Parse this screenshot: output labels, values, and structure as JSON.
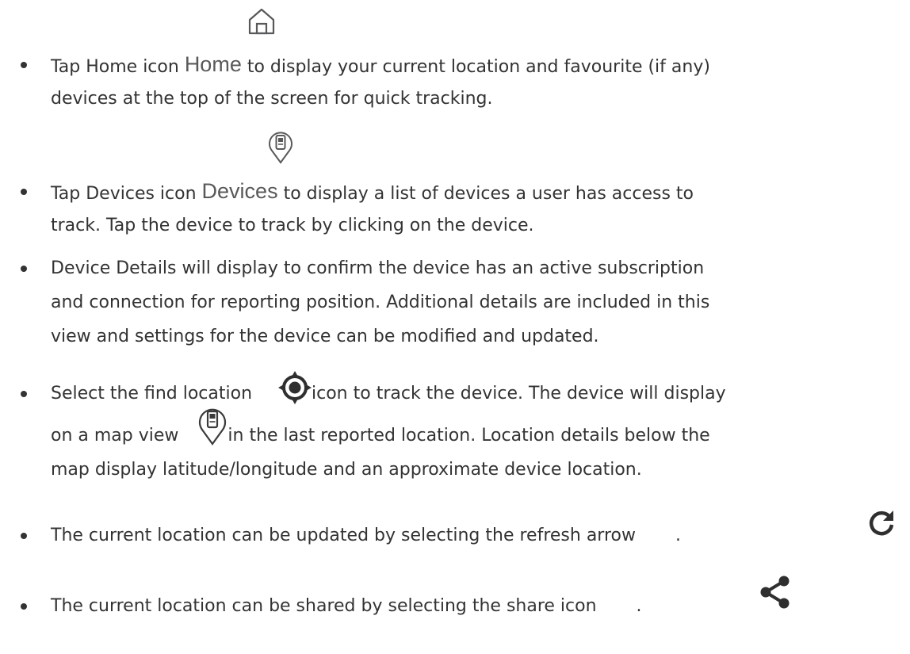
{
  "bullets": [
    {
      "line1_before": "Tap Home icon ",
      "label": "Home",
      "line1_after": " to display your current location and favourite (if any)",
      "line2": "devices at the top of the screen for quick tracking."
    },
    {
      "line1_before": "Tap Devices icon ",
      "label": "Devices",
      "line1_after": " to display a list of devices a user has access to",
      "line2": "track. Tap the device to track by clicking on the device."
    },
    {
      "line1": "Device Details will display to confirm the device has an active subscription",
      "line2": "and connection for reporting position. Additional details are included in this",
      "line3": "view and settings for the device can be modified and updated."
    },
    {
      "line1_before": "Select the find location",
      "line1_after": "icon to track the device. The device will display",
      "line2_before": "on a map view",
      "line2_after": "in the last reported location. Location details below the",
      "line3": "map display latitude/longitude and an approximate device location."
    },
    {
      "line1_before": "The current location can be updated by selecting the refresh arrow",
      "line1_after": "."
    },
    {
      "line1_before": "The current location can be shared by selecting the share icon",
      "line1_after": "."
    }
  ],
  "icons": {
    "home": "home-icon",
    "devices": "device-pin-icon",
    "find_location": "target-location-icon",
    "map_pin": "device-pin-icon",
    "refresh": "refresh-arrow-icon",
    "share": "share-icon"
  },
  "colors": {
    "text": "#333333",
    "label": "#58595b",
    "icon": "#2f2f2f"
  }
}
